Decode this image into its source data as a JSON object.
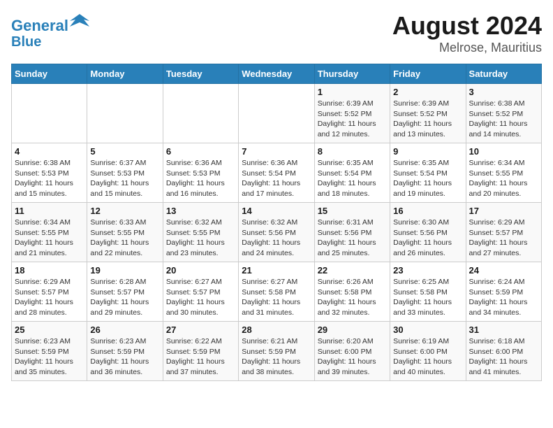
{
  "logo": {
    "line1": "General",
    "line2": "Blue"
  },
  "title": "August 2024",
  "subtitle": "Melrose, Mauritius",
  "weekdays": [
    "Sunday",
    "Monday",
    "Tuesday",
    "Wednesday",
    "Thursday",
    "Friday",
    "Saturday"
  ],
  "weeks": [
    [
      {
        "day": "",
        "info": ""
      },
      {
        "day": "",
        "info": ""
      },
      {
        "day": "",
        "info": ""
      },
      {
        "day": "",
        "info": ""
      },
      {
        "day": "1",
        "info": "Sunrise: 6:39 AM\nSunset: 5:52 PM\nDaylight: 11 hours\nand 12 minutes."
      },
      {
        "day": "2",
        "info": "Sunrise: 6:39 AM\nSunset: 5:52 PM\nDaylight: 11 hours\nand 13 minutes."
      },
      {
        "day": "3",
        "info": "Sunrise: 6:38 AM\nSunset: 5:52 PM\nDaylight: 11 hours\nand 14 minutes."
      }
    ],
    [
      {
        "day": "4",
        "info": "Sunrise: 6:38 AM\nSunset: 5:53 PM\nDaylight: 11 hours\nand 15 minutes."
      },
      {
        "day": "5",
        "info": "Sunrise: 6:37 AM\nSunset: 5:53 PM\nDaylight: 11 hours\nand 15 minutes."
      },
      {
        "day": "6",
        "info": "Sunrise: 6:36 AM\nSunset: 5:53 PM\nDaylight: 11 hours\nand 16 minutes."
      },
      {
        "day": "7",
        "info": "Sunrise: 6:36 AM\nSunset: 5:54 PM\nDaylight: 11 hours\nand 17 minutes."
      },
      {
        "day": "8",
        "info": "Sunrise: 6:35 AM\nSunset: 5:54 PM\nDaylight: 11 hours\nand 18 minutes."
      },
      {
        "day": "9",
        "info": "Sunrise: 6:35 AM\nSunset: 5:54 PM\nDaylight: 11 hours\nand 19 minutes."
      },
      {
        "day": "10",
        "info": "Sunrise: 6:34 AM\nSunset: 5:55 PM\nDaylight: 11 hours\nand 20 minutes."
      }
    ],
    [
      {
        "day": "11",
        "info": "Sunrise: 6:34 AM\nSunset: 5:55 PM\nDaylight: 11 hours\nand 21 minutes."
      },
      {
        "day": "12",
        "info": "Sunrise: 6:33 AM\nSunset: 5:55 PM\nDaylight: 11 hours\nand 22 minutes."
      },
      {
        "day": "13",
        "info": "Sunrise: 6:32 AM\nSunset: 5:55 PM\nDaylight: 11 hours\nand 23 minutes."
      },
      {
        "day": "14",
        "info": "Sunrise: 6:32 AM\nSunset: 5:56 PM\nDaylight: 11 hours\nand 24 minutes."
      },
      {
        "day": "15",
        "info": "Sunrise: 6:31 AM\nSunset: 5:56 PM\nDaylight: 11 hours\nand 25 minutes."
      },
      {
        "day": "16",
        "info": "Sunrise: 6:30 AM\nSunset: 5:56 PM\nDaylight: 11 hours\nand 26 minutes."
      },
      {
        "day": "17",
        "info": "Sunrise: 6:29 AM\nSunset: 5:57 PM\nDaylight: 11 hours\nand 27 minutes."
      }
    ],
    [
      {
        "day": "18",
        "info": "Sunrise: 6:29 AM\nSunset: 5:57 PM\nDaylight: 11 hours\nand 28 minutes."
      },
      {
        "day": "19",
        "info": "Sunrise: 6:28 AM\nSunset: 5:57 PM\nDaylight: 11 hours\nand 29 minutes."
      },
      {
        "day": "20",
        "info": "Sunrise: 6:27 AM\nSunset: 5:57 PM\nDaylight: 11 hours\nand 30 minutes."
      },
      {
        "day": "21",
        "info": "Sunrise: 6:27 AM\nSunset: 5:58 PM\nDaylight: 11 hours\nand 31 minutes."
      },
      {
        "day": "22",
        "info": "Sunrise: 6:26 AM\nSunset: 5:58 PM\nDaylight: 11 hours\nand 32 minutes."
      },
      {
        "day": "23",
        "info": "Sunrise: 6:25 AM\nSunset: 5:58 PM\nDaylight: 11 hours\nand 33 minutes."
      },
      {
        "day": "24",
        "info": "Sunrise: 6:24 AM\nSunset: 5:59 PM\nDaylight: 11 hours\nand 34 minutes."
      }
    ],
    [
      {
        "day": "25",
        "info": "Sunrise: 6:23 AM\nSunset: 5:59 PM\nDaylight: 11 hours\nand 35 minutes."
      },
      {
        "day": "26",
        "info": "Sunrise: 6:23 AM\nSunset: 5:59 PM\nDaylight: 11 hours\nand 36 minutes."
      },
      {
        "day": "27",
        "info": "Sunrise: 6:22 AM\nSunset: 5:59 PM\nDaylight: 11 hours\nand 37 minutes."
      },
      {
        "day": "28",
        "info": "Sunrise: 6:21 AM\nSunset: 5:59 PM\nDaylight: 11 hours\nand 38 minutes."
      },
      {
        "day": "29",
        "info": "Sunrise: 6:20 AM\nSunset: 6:00 PM\nDaylight: 11 hours\nand 39 minutes."
      },
      {
        "day": "30",
        "info": "Sunrise: 6:19 AM\nSunset: 6:00 PM\nDaylight: 11 hours\nand 40 minutes."
      },
      {
        "day": "31",
        "info": "Sunrise: 6:18 AM\nSunset: 6:00 PM\nDaylight: 11 hours\nand 41 minutes."
      }
    ]
  ]
}
